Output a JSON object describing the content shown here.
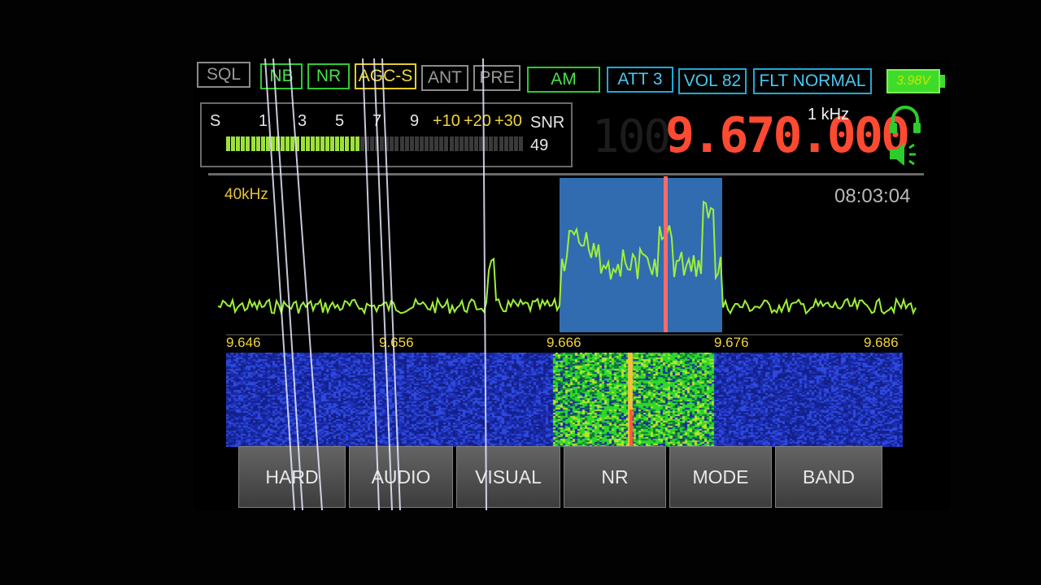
{
  "status_bar": {
    "chips": [
      {
        "label": "SQL",
        "style": "gray"
      },
      {
        "label": "NB",
        "style": "green"
      },
      {
        "label": "NR",
        "style": "green"
      },
      {
        "label": "AGC-S",
        "style": "yellow"
      },
      {
        "label": "ANT",
        "style": "gray"
      },
      {
        "label": "PRE",
        "style": "gray"
      },
      {
        "label": "AM",
        "style": "green"
      },
      {
        "label": "ATT 3",
        "style": "cyan"
      },
      {
        "label": "VOL 82",
        "style": "cyan"
      },
      {
        "label": "FLT NORMAL",
        "style": "cyan"
      }
    ],
    "battery": "3.98V"
  },
  "s_meter": {
    "labels": [
      "S",
      "1",
      "3",
      "5",
      "7",
      "9",
      "+10",
      "+20",
      "+30"
    ],
    "snr_label": "SNR",
    "snr_value": "49",
    "level": 0.45
  },
  "frequency": {
    "ghost": "100",
    "value": "9.670.000",
    "step": "1 kHz"
  },
  "spectrum": {
    "span_label": "40kHz",
    "clock": "08:03:04",
    "axis_labels": [
      "9.646",
      "9.656",
      "9.666",
      "9.676",
      "9.686"
    ],
    "passband_color": "#3a7fd0",
    "trace_color": "#9ef03a",
    "marker_color": "#ff6a6a"
  },
  "icons": {
    "headphones": "headphones-icon",
    "speaker": "speaker-icon"
  },
  "softkeys": [
    "HARD",
    "AUDIO",
    "VISUAL",
    "NR",
    "MODE",
    "BAND"
  ]
}
